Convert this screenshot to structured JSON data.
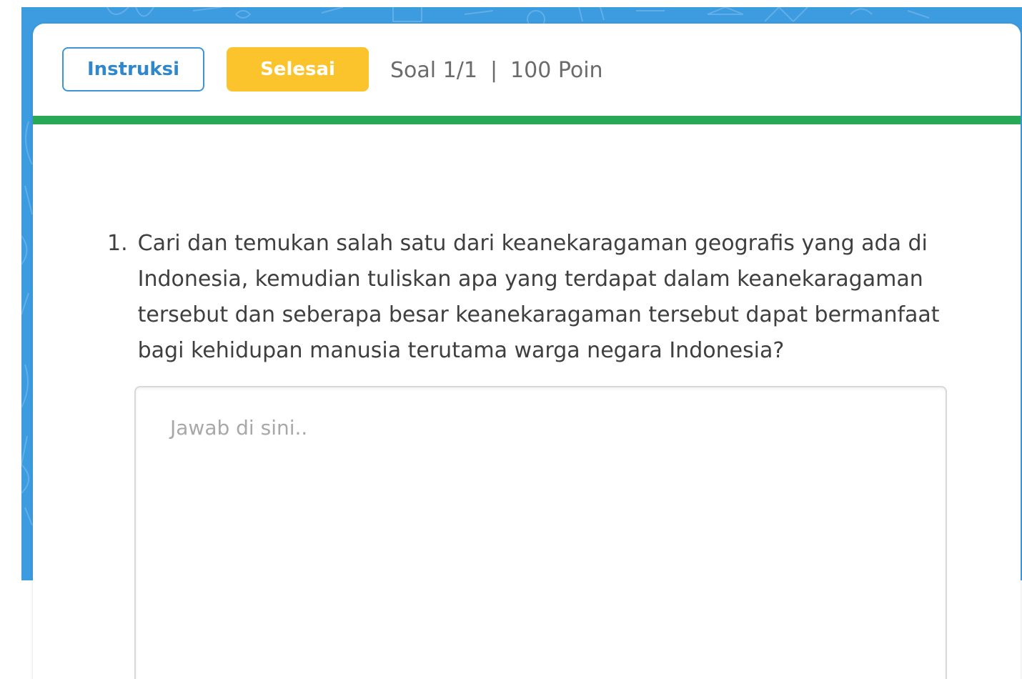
{
  "header": {
    "instruction_label": "Instruksi",
    "finish_label": "Selesai",
    "question_counter": "Soal 1/1",
    "separator": "|",
    "points": "100 Poin"
  },
  "question": {
    "number": "1.",
    "text": "Cari dan temukan salah satu dari keanekaragaman geografis yang ada di Indonesia, kemudian tuliskan apa yang terdapat dalam keanekaragaman tersebut dan seberapa besar keanekaragaman tersebut dapat bermanfaat bagi kehidupan manusia terutama warga negara Indonesia?"
  },
  "answer": {
    "placeholder": "Jawab di sini..",
    "value": ""
  },
  "colors": {
    "backdrop": "#3d9be0",
    "instruction_border": "#3d95d8",
    "finish_button": "#fbc42d",
    "progress_bar": "#27a957"
  },
  "progress": {
    "fraction": 1.0
  }
}
